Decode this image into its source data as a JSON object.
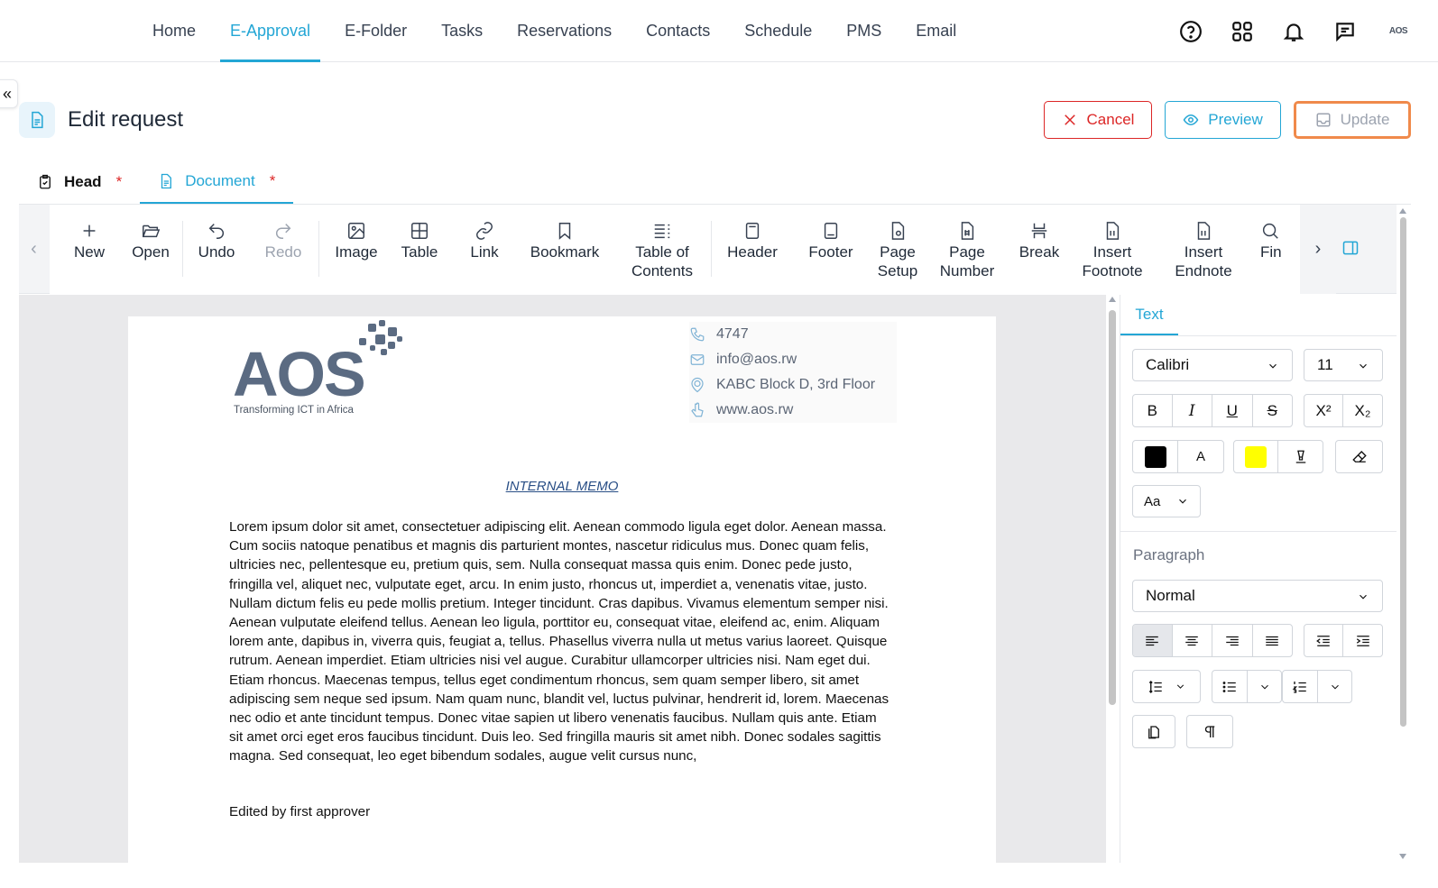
{
  "nav": {
    "items": [
      {
        "label": "Home"
      },
      {
        "label": "E-Approval",
        "active": true
      },
      {
        "label": "E-Folder"
      },
      {
        "label": "Tasks"
      },
      {
        "label": "Reservations"
      },
      {
        "label": "Contacts"
      },
      {
        "label": "Schedule"
      },
      {
        "label": "PMS"
      },
      {
        "label": "Email"
      }
    ],
    "icons": [
      "help-icon",
      "apps-grid-icon",
      "bell-icon",
      "chat-icon"
    ],
    "avatar_text": "AOS"
  },
  "page": {
    "title": "Edit request",
    "collapse_glyph": "«"
  },
  "actions": {
    "cancel_label": "Cancel",
    "preview_label": "Preview",
    "update_label": "Update"
  },
  "tabs": [
    {
      "label": "Head",
      "required": "*",
      "active": false
    },
    {
      "label": "Document",
      "required": "*",
      "active": true
    }
  ],
  "ribbon": {
    "items": [
      {
        "name": "new",
        "label": "New",
        "icon": "plus-icon"
      },
      {
        "name": "open",
        "label": "Open",
        "icon": "folder-open-icon"
      },
      {
        "name": "undo",
        "label": "Undo",
        "icon": "undo-icon"
      },
      {
        "name": "redo",
        "label": "Redo",
        "icon": "redo-icon",
        "disabled": true
      },
      {
        "name": "image",
        "label": "Image",
        "icon": "image-icon"
      },
      {
        "name": "table",
        "label": "Table",
        "icon": "table-icon"
      },
      {
        "name": "link",
        "label": "Link",
        "icon": "link-icon"
      },
      {
        "name": "bookmark",
        "label": "Bookmark",
        "icon": "bookmark-icon"
      },
      {
        "name": "toc",
        "label": "Table of\nContents",
        "icon": "toc-icon"
      },
      {
        "name": "header",
        "label": "Header",
        "icon": "header-icon"
      },
      {
        "name": "footer",
        "label": "Footer",
        "icon": "footer-icon"
      },
      {
        "name": "page-setup",
        "label": "Page\nSetup",
        "icon": "page-setup-icon"
      },
      {
        "name": "page-number",
        "label": "Page\nNumber",
        "icon": "page-number-icon"
      },
      {
        "name": "break",
        "label": "Break",
        "icon": "break-icon"
      },
      {
        "name": "insert-footnote",
        "label": "Insert\nFootnote",
        "icon": "footnote-icon"
      },
      {
        "name": "insert-endnote",
        "label": "Insert\nEndnote",
        "icon": "endnote-icon"
      },
      {
        "name": "find",
        "label": "Fin",
        "icon": "search-icon"
      }
    ]
  },
  "document": {
    "logo_text": "AOS",
    "logo_tagline": "Transforming ICT in Africa",
    "contact": {
      "phone": "4747",
      "email": "info@aos.rw",
      "address": "KABC Block D, 3rd Floor",
      "website": "www.aos.rw"
    },
    "memo_title": "INTERNAL MEMO",
    "body": "Lorem ipsum dolor sit amet, consectetuer adipiscing elit. Aenean commodo ligula eget dolor. Aenean massa. Cum sociis natoque penatibus et magnis dis parturient montes, nascetur ridiculus mus. Donec quam felis, ultricies nec, pellentesque eu, pretium quis, sem. Nulla consequat massa quis enim. Donec pede justo, fringilla vel, aliquet nec, vulputate eget, arcu. In enim justo, rhoncus ut, imperdiet a, venenatis vitae, justo. Nullam dictum felis eu pede mollis pretium. Integer tincidunt. Cras dapibus. Vivamus elementum semper nisi. Aenean vulputate eleifend tellus. Aenean leo ligula, porttitor eu, consequat vitae, eleifend ac, enim. Aliquam lorem ante, dapibus in, viverra quis, feugiat a, tellus. Phasellus viverra nulla ut metus varius laoreet. Quisque rutrum. Aenean imperdiet. Etiam ultricies nisi vel augue. Curabitur ullamcorper ultricies nisi. Nam eget dui. Etiam rhoncus. Maecenas tempus, tellus eget condimentum rhoncus, sem quam semper libero, sit amet adipiscing sem neque sed ipsum. Nam quam nunc, blandit vel, luctus pulvinar, hendrerit id, lorem. Maecenas nec odio et ante tincidunt tempus. Donec vitae sapien ut libero venenatis faucibus. Nullam quis ante. Etiam sit amet orci eget eros faucibus tincidunt. Duis leo. Sed fringilla mauris sit amet nibh. Donec sodales sagittis magna. Sed consequat, leo eget bibendum sodales, augue velit cursus nunc,",
    "signature": "Edited by first approver"
  },
  "side_panel": {
    "tab_label": "Text",
    "font_family": "Calibri",
    "font_size": "11",
    "format_buttons": {
      "bold": "B",
      "italic": "I",
      "underline": "U",
      "strike": "S",
      "superscript": "X²",
      "subscript": "X₂"
    },
    "font_color": "#000000",
    "font_color_label": "A",
    "highlight_color": "#ffff00",
    "change_case_label": "Aa",
    "paragraph_label": "Paragraph",
    "paragraph_style": "Normal",
    "alignment": "left"
  },
  "colors": {
    "accent": "#23a6d5",
    "danger": "#dc2626",
    "update_border": "#f08a4b"
  }
}
